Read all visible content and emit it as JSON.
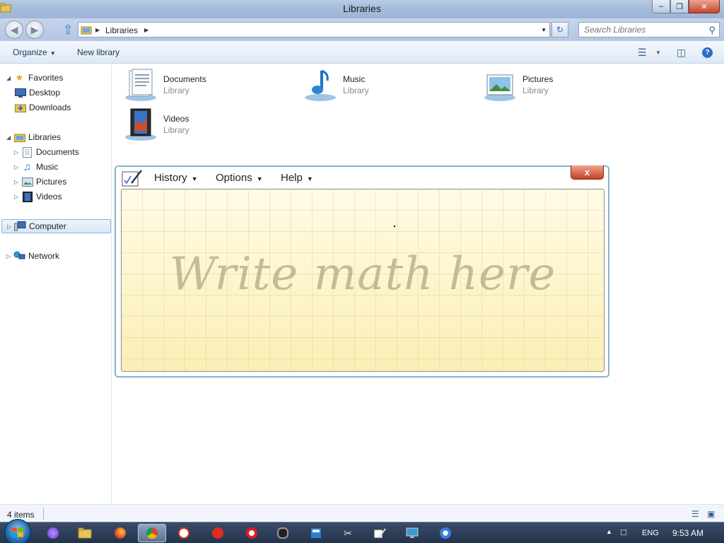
{
  "window": {
    "title": "Libraries"
  },
  "address": {
    "crumb": "Libraries",
    "search_placeholder": "Search Libraries"
  },
  "commandbar": {
    "organize": "Organize",
    "new_library": "New library"
  },
  "nav": {
    "favorites": "Favorites",
    "desktop": "Desktop",
    "downloads": "Downloads",
    "libraries": "Libraries",
    "documents": "Documents",
    "music": "Music",
    "pictures": "Pictures",
    "videos": "Videos",
    "computer": "Computer",
    "network": "Network"
  },
  "libraries": [
    {
      "name": "Documents",
      "type": "Library"
    },
    {
      "name": "Music",
      "type": "Library"
    },
    {
      "name": "Pictures",
      "type": "Library"
    },
    {
      "name": "Videos",
      "type": "Library"
    }
  ],
  "math_panel": {
    "menus": [
      "History",
      "Options",
      "Help"
    ],
    "close": "x",
    "hint": "Write math here"
  },
  "status": {
    "count": "4 items"
  },
  "taskbar": {
    "language": "ENG",
    "time": "9:53 AM"
  }
}
